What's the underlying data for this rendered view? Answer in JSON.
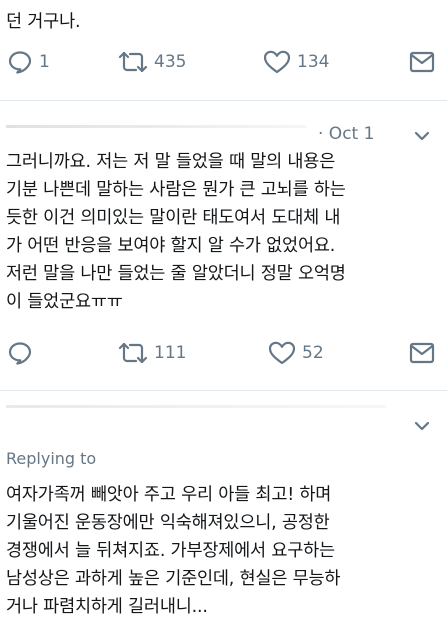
{
  "tweets": [
    {
      "text": "던 거구나.",
      "replies": "1",
      "retweets": "435",
      "likes": "134"
    },
    {
      "date": "· Oct 1",
      "text": "그러니까요. 저는 저 말 들었을 때 말의 내용은\n기분 나쁜데 말하는 사람은 뭔가 큰 고뇌를 하는\n듯한 이건 의미있는 말이란 태도여서 도대체 내\n가 어떤 반응을 보여야 할지 알 수가 없었어요.\n저런 말을 나만 들었는 줄 알았더니 정말 오억명\n이 들었군요ㅠㅠ",
      "replies": "",
      "retweets": "111",
      "likes": "52"
    },
    {
      "replying_to": "Replying to",
      "text": "여자가족꺼 빼앗아 주고 우리 아들 최고! 하며\n기울어진 운동장에만 익숙해져있으니, 공정한\n경쟁에서 늘 뒤쳐지죠. 가부장제에서 요구하는\n남성상은 과하게 높은 기준인데, 현실은 무능하\n거나 파렴치하게 길러내니..."
    }
  ],
  "icons": {
    "reply": "reply-icon",
    "retweet": "retweet-icon",
    "like": "heart-icon",
    "share": "envelope-icon",
    "more": "chevron-down-icon"
  },
  "colors": {
    "icon": "#657786",
    "separator": "#e1e8ed",
    "text": "#14171a"
  }
}
